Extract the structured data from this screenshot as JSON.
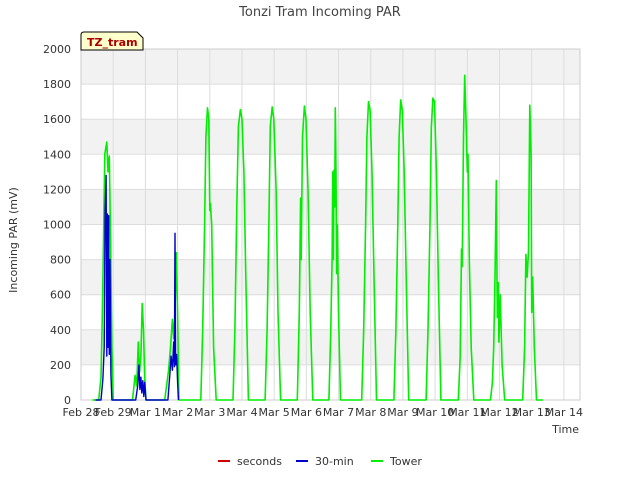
{
  "chart_data": {
    "type": "line",
    "title": "Tonzi Tram Incoming PAR",
    "xlabel": "Time",
    "ylabel": "Incoming PAR (mV)",
    "tag": "TZ_tram",
    "ylim": [
      0,
      2000
    ],
    "yticks": [
      0,
      200,
      400,
      600,
      800,
      1000,
      1200,
      1400,
      1600,
      1800,
      2000
    ],
    "xlim": [
      0,
      15.5
    ],
    "xticks": [
      {
        "x": 0,
        "label": "Feb 28"
      },
      {
        "x": 1,
        "label": "Feb 29"
      },
      {
        "x": 2,
        "label": "Mar 1"
      },
      {
        "x": 3,
        "label": "Mar 2"
      },
      {
        "x": 4,
        "label": "Mar 3"
      },
      {
        "x": 5,
        "label": "Mar 4"
      },
      {
        "x": 6,
        "label": "Mar 5"
      },
      {
        "x": 7,
        "label": "Mar 6"
      },
      {
        "x": 8,
        "label": "Mar 7"
      },
      {
        "x": 9,
        "label": "Mar 8"
      },
      {
        "x": 10,
        "label": "Mar 9"
      },
      {
        "x": 11,
        "label": "Mar 10"
      },
      {
        "x": 12,
        "label": "Mar 11"
      },
      {
        "x": 13,
        "label": "Mar 12"
      },
      {
        "x": 14,
        "label": "Mar 13"
      },
      {
        "x": 15,
        "label": "Mar 14"
      }
    ],
    "grid": true,
    "legend_position": "bottom-center",
    "series": [
      {
        "name": "seconds",
        "color": "#cc0000",
        "points": []
      },
      {
        "name": "30-min",
        "color": "#0000cc",
        "points": [
          [
            0.45,
            0
          ],
          [
            0.62,
            0
          ],
          [
            0.68,
            120
          ],
          [
            0.72,
            300
          ],
          [
            0.75,
            1080
          ],
          [
            0.78,
            1280
          ],
          [
            0.8,
            250
          ],
          [
            0.82,
            1060
          ],
          [
            0.84,
            300
          ],
          [
            0.86,
            1050
          ],
          [
            0.88,
            260
          ],
          [
            0.9,
            800
          ],
          [
            0.93,
            150
          ],
          [
            0.96,
            0
          ],
          [
            1.7,
            0
          ],
          [
            1.76,
            80
          ],
          [
            1.8,
            200
          ],
          [
            1.83,
            60
          ],
          [
            1.86,
            130
          ],
          [
            1.89,
            40
          ],
          [
            1.92,
            110
          ],
          [
            1.95,
            20
          ],
          [
            1.98,
            100
          ],
          [
            2.02,
            0
          ],
          [
            2.7,
            0
          ],
          [
            2.76,
            150
          ],
          [
            2.8,
            250
          ],
          [
            2.84,
            170
          ],
          [
            2.88,
            330
          ],
          [
            2.9,
            190
          ],
          [
            2.92,
            950
          ],
          [
            2.94,
            200
          ],
          [
            2.97,
            260
          ],
          [
            3.0,
            100
          ],
          [
            3.03,
            0
          ]
        ]
      },
      {
        "name": "Tower",
        "color": "#00ee00",
        "points": [
          [
            0.35,
            0
          ],
          [
            0.55,
            0
          ],
          [
            0.62,
            130
          ],
          [
            0.66,
            450
          ],
          [
            0.7,
            900
          ],
          [
            0.74,
            1400
          ],
          [
            0.8,
            1470
          ],
          [
            0.84,
            1300
          ],
          [
            0.88,
            1390
          ],
          [
            0.92,
            900
          ],
          [
            0.96,
            300
          ],
          [
            1.0,
            0
          ],
          [
            1.6,
            0
          ],
          [
            1.68,
            140
          ],
          [
            1.73,
            80
          ],
          [
            1.78,
            330
          ],
          [
            1.82,
            160
          ],
          [
            1.86,
            250
          ],
          [
            1.9,
            550
          ],
          [
            1.94,
            400
          ],
          [
            1.98,
            120
          ],
          [
            2.02,
            0
          ],
          [
            2.6,
            0
          ],
          [
            2.72,
            170
          ],
          [
            2.78,
            300
          ],
          [
            2.84,
            460
          ],
          [
            2.88,
            350
          ],
          [
            2.92,
            500
          ],
          [
            2.96,
            840
          ],
          [
            3.0,
            500
          ],
          [
            3.04,
            0
          ],
          [
            3.6,
            0
          ],
          [
            3.72,
            0
          ],
          [
            3.78,
            400
          ],
          [
            3.84,
            1000
          ],
          [
            3.88,
            1500
          ],
          [
            3.93,
            1665
          ],
          [
            3.97,
            1600
          ],
          [
            4.0,
            1080
          ],
          [
            4.02,
            1120
          ],
          [
            4.06,
            1000
          ],
          [
            4.12,
            300
          ],
          [
            4.2,
            0
          ],
          [
            4.62,
            0
          ],
          [
            4.72,
            0
          ],
          [
            4.78,
            400
          ],
          [
            4.84,
            1100
          ],
          [
            4.89,
            1560
          ],
          [
            4.95,
            1655
          ],
          [
            5.0,
            1600
          ],
          [
            5.06,
            1300
          ],
          [
            5.12,
            700
          ],
          [
            5.2,
            0
          ],
          [
            5.62,
            0
          ],
          [
            5.72,
            0
          ],
          [
            5.78,
            400
          ],
          [
            5.84,
            1050
          ],
          [
            5.88,
            1560
          ],
          [
            5.94,
            1670
          ],
          [
            5.99,
            1600
          ],
          [
            6.06,
            1200
          ],
          [
            6.12,
            500
          ],
          [
            6.2,
            0
          ],
          [
            6.62,
            0
          ],
          [
            6.72,
            0
          ],
          [
            6.78,
            500
          ],
          [
            6.82,
            1150
          ],
          [
            6.84,
            800
          ],
          [
            6.88,
            1500
          ],
          [
            6.94,
            1675
          ],
          [
            6.99,
            1600
          ],
          [
            7.05,
            1200
          ],
          [
            7.12,
            500
          ],
          [
            7.2,
            0
          ],
          [
            7.62,
            0
          ],
          [
            7.7,
            0
          ],
          [
            7.76,
            400
          ],
          [
            7.8,
            800
          ],
          [
            7.82,
            1300
          ],
          [
            7.84,
            800
          ],
          [
            7.86,
            1310
          ],
          [
            7.88,
            1100
          ],
          [
            7.9,
            1665
          ],
          [
            7.92,
            1300
          ],
          [
            7.94,
            720
          ],
          [
            7.96,
            1000
          ],
          [
            8.0,
            500
          ],
          [
            8.06,
            0
          ],
          [
            8.62,
            0
          ],
          [
            8.72,
            0
          ],
          [
            8.78,
            400
          ],
          [
            8.84,
            1000
          ],
          [
            8.88,
            1500
          ],
          [
            8.93,
            1700
          ],
          [
            8.98,
            1650
          ],
          [
            9.04,
            1300
          ],
          [
            9.1,
            700
          ],
          [
            9.18,
            0
          ],
          [
            9.62,
            0
          ],
          [
            9.72,
            0
          ],
          [
            9.78,
            400
          ],
          [
            9.84,
            1000
          ],
          [
            9.88,
            1500
          ],
          [
            9.93,
            1710
          ],
          [
            9.98,
            1650
          ],
          [
            10.04,
            1300
          ],
          [
            10.1,
            700
          ],
          [
            10.18,
            0
          ],
          [
            10.62,
            0
          ],
          [
            10.72,
            0
          ],
          [
            10.78,
            400
          ],
          [
            10.84,
            1000
          ],
          [
            10.88,
            1550
          ],
          [
            10.93,
            1720
          ],
          [
            10.98,
            1700
          ],
          [
            11.04,
            1300
          ],
          [
            11.1,
            700
          ],
          [
            11.18,
            0
          ],
          [
            11.62,
            0
          ],
          [
            11.72,
            0
          ],
          [
            11.78,
            250
          ],
          [
            11.82,
            860
          ],
          [
            11.84,
            760
          ],
          [
            11.88,
            1500
          ],
          [
            11.92,
            1850
          ],
          [
            11.96,
            1600
          ],
          [
            12.0,
            1300
          ],
          [
            12.02,
            1400
          ],
          [
            12.06,
            800
          ],
          [
            12.12,
            300
          ],
          [
            12.2,
            0
          ],
          [
            12.62,
            0
          ],
          [
            12.72,
            0
          ],
          [
            12.78,
            100
          ],
          [
            12.82,
            300
          ],
          [
            12.86,
            700
          ],
          [
            12.9,
            1250
          ],
          [
            12.93,
            470
          ],
          [
            12.96,
            670
          ],
          [
            12.98,
            330
          ],
          [
            13.02,
            600
          ],
          [
            13.08,
            200
          ],
          [
            13.16,
            0
          ],
          [
            13.62,
            0
          ],
          [
            13.72,
            0
          ],
          [
            13.78,
            300
          ],
          [
            13.82,
            830
          ],
          [
            13.86,
            700
          ],
          [
            13.9,
            850
          ],
          [
            13.94,
            1680
          ],
          [
            13.98,
            1400
          ],
          [
            14.0,
            500
          ],
          [
            14.03,
            700
          ],
          [
            14.08,
            300
          ],
          [
            14.15,
            0
          ],
          [
            14.35,
            0
          ]
        ]
      }
    ]
  }
}
